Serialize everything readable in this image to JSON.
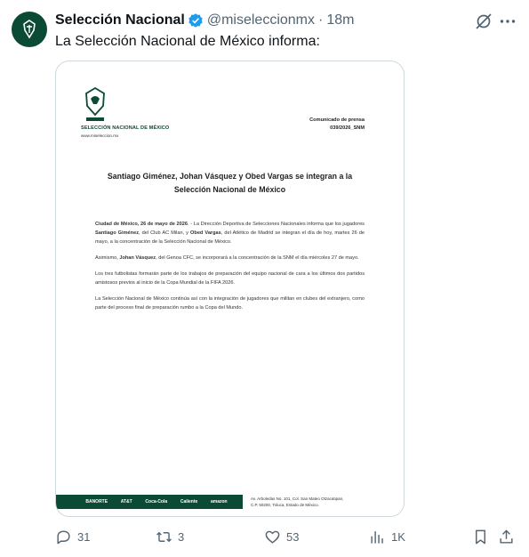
{
  "tweet": {
    "author_name": "Selección Nacional",
    "handle": "@miseleccionmx",
    "separator": "·",
    "time": "18m",
    "text": "La Selección Nacional de México informa:"
  },
  "document": {
    "org_name": "SELECCIÓN NACIONAL DE MÉXICO",
    "website": "www.miseleccion.mx",
    "press_label": "Comunicado de prensa",
    "press_number": "039/2026_SNM",
    "title_line1": "Santiago Giménez, Johan Vásquez y Obed Vargas se integran a la",
    "title_line2": "Selección Nacional de México",
    "p1_lead": "Ciudad de México, 26 de mayo de 2026",
    "p1_a": ". - La Dirección Deportiva de Selecciones Nacionales informa que los jugadores ",
    "p1_name1": "Santiago Giménez",
    "p1_b": ", del Club AC Milan, y ",
    "p1_name2": "Obed Vargas",
    "p1_c": ", del Atlético de Madrid se integran el día de hoy, martes 26 de mayo, a la concentración de la Selección Nacional de México.",
    "p2_a": "Asimismo, ",
    "p2_name": "Johan Vásquez",
    "p2_b": ", del Genoa CFC, se incorporará a la concentración de la SNM el día miércoles 27 de mayo.",
    "p3": "Los tres  futbolistas formarán parte de  los trabajos de preparación del equipo nacional de cara a los últimos dos partidos amistosos previos al inicio de la Copa Mundial de la FIFA 2026.",
    "p4": "La Selección Nacional de México continúa así con la integración de jugadores que militan en clubes del extranjero, como parte del proceso final de preparación rumbo a la Copa del Mundo.",
    "sponsors": [
      "BANORTE",
      "AT&T",
      "Coca-Cola",
      "Caliente",
      "amazon"
    ],
    "address_line1": "Av. Arboledas No. 101, Col. San Mateo Otzacatipan,",
    "address_line2": "C.P. 50200, Toluca, Estado de México."
  },
  "actions": {
    "replies": "31",
    "reposts": "3",
    "likes": "53",
    "views": "1K"
  },
  "colors": {
    "brand_green": "#0b4a35",
    "verified_blue": "#1d9bf0",
    "muted_text": "#536471"
  },
  "icons": [
    "avatar-logo",
    "verified-badge-icon",
    "grok-icon",
    "more-icon",
    "reply-icon",
    "repost-icon",
    "like-icon",
    "views-icon",
    "bookmark-icon",
    "share-icon"
  ]
}
